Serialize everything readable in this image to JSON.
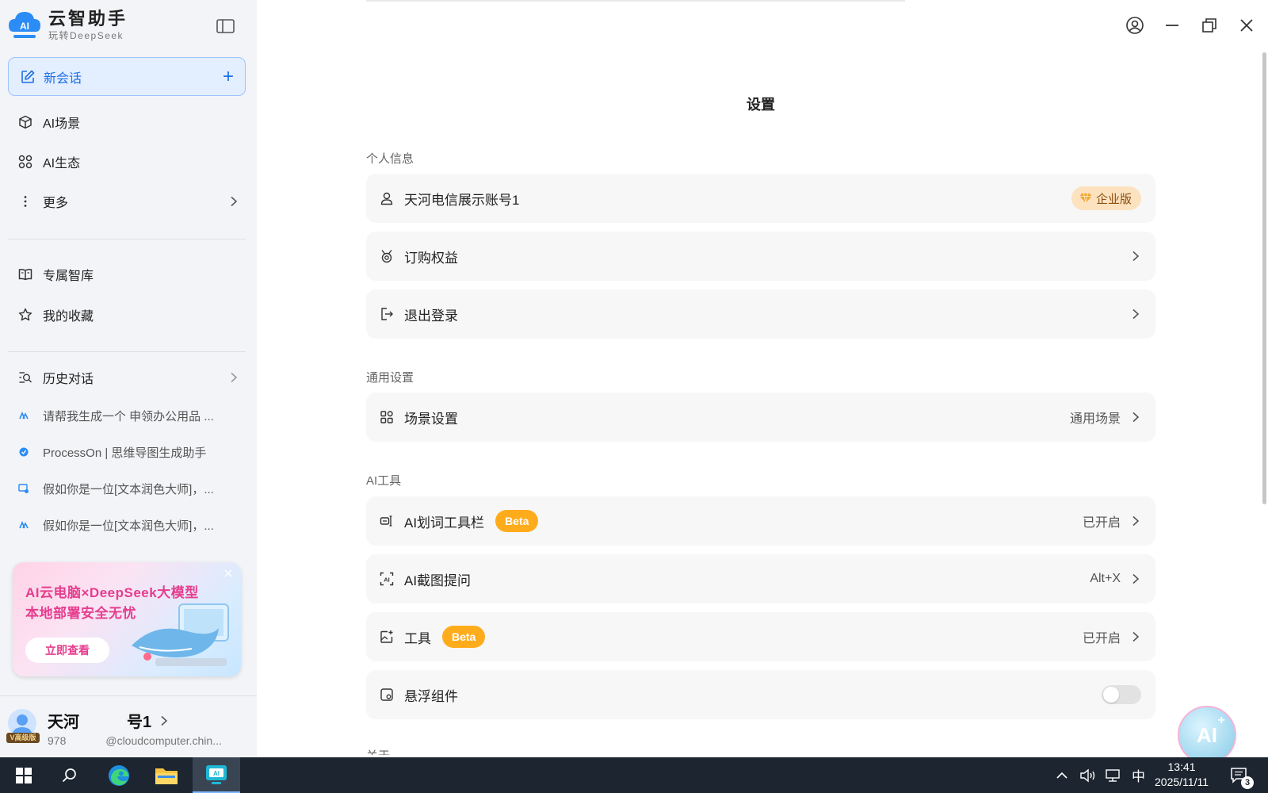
{
  "app": {
    "name": "云智助手",
    "subtitle": "玩转DeepSeek"
  },
  "sidebar": {
    "new_chat": "新会话",
    "nav": [
      {
        "label": "AI场景"
      },
      {
        "label": "AI生态"
      },
      {
        "label": "更多"
      }
    ],
    "library": [
      {
        "label": "专属智库"
      },
      {
        "label": "我的收藏"
      }
    ],
    "history_title": "历史对话",
    "history": [
      {
        "label": "请帮我生成一个 申领办公用品 ..."
      },
      {
        "label": "ProcessOn | 思维导图生成助手"
      },
      {
        "label": "假如你是一位[文本润色大师]，..."
      },
      {
        "label": "假如你是一位[文本润色大师]，..."
      }
    ],
    "promo": {
      "line1": "AI云电脑×DeepSeek大模型",
      "line2": "本地部署安全无忧",
      "button": "立即查看"
    },
    "user": {
      "name_prefix": "天河",
      "name_suffix": "号1",
      "email_prefix": "978",
      "email_suffix": "@cloudcomputer.chin...",
      "vip_label": "V高级版"
    }
  },
  "main": {
    "title": "设置",
    "sections": [
      {
        "title": "个人信息"
      },
      {
        "title": "通用设置"
      },
      {
        "title": "AI工具"
      },
      {
        "title": "关于"
      }
    ],
    "rows": {
      "account": {
        "label": "天河电信展示账号1",
        "badge": "企业版"
      },
      "subscription": {
        "label": "订购权益"
      },
      "logout": {
        "label": "退出登录"
      },
      "scene": {
        "label": "场景设置",
        "value": "通用场景"
      },
      "word_toolbar": {
        "label": "AI划词工具栏",
        "badge": "Beta",
        "value": "已开启"
      },
      "screenshot": {
        "label": "AI截图提问",
        "value": "Alt+X"
      },
      "tools": {
        "label": "工具",
        "badge": "Beta",
        "value": "已开启"
      },
      "floating": {
        "label": "悬浮组件",
        "toggle_on": false
      }
    }
  },
  "float_button": {
    "label": "AI"
  },
  "taskbar": {
    "time": "13:41",
    "date": "2025/11/11",
    "ime": "中",
    "notifications": "3"
  },
  "colors": {
    "accent": "#1d6fe8",
    "beta": "#ffac1c",
    "enterprise_badge": "#fde2c0",
    "sidebar_bg": "#f2f4f7"
  }
}
